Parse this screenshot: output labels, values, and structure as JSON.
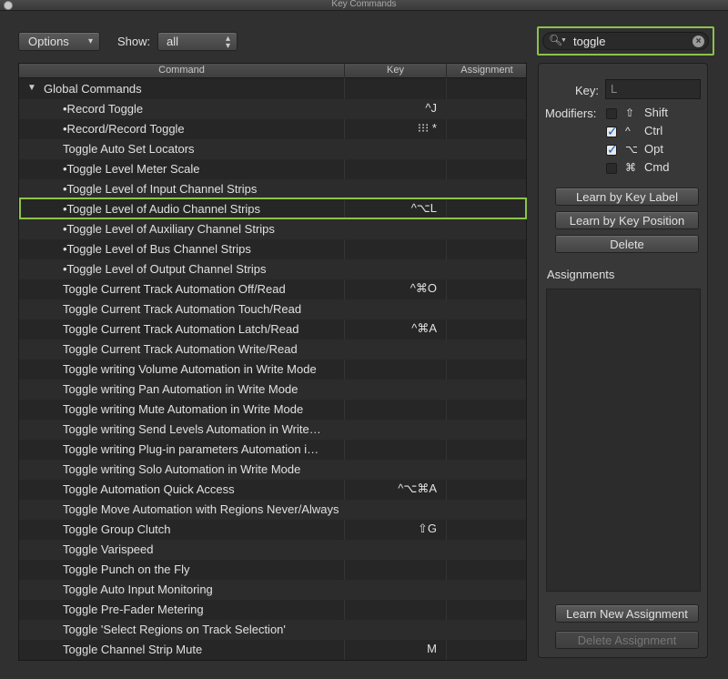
{
  "window": {
    "title": "Key Commands"
  },
  "toolbar": {
    "options_label": "Options",
    "show_label": "Show:",
    "show_value": "all"
  },
  "search": {
    "value": "toggle"
  },
  "table": {
    "headers": {
      "command": "Command",
      "key": "Key",
      "assignment": "Assignment"
    },
    "group": "Global Commands",
    "rows": [
      {
        "cmd": "•Record Toggle",
        "key": "^J"
      },
      {
        "cmd": "•Record/Record Toggle",
        "key": "⁝⁝⁝ *"
      },
      {
        "cmd": "Toggle Auto Set Locators",
        "key": ""
      },
      {
        "cmd": "•Toggle Level Meter Scale",
        "key": ""
      },
      {
        "cmd": "•Toggle Level of Input Channel Strips",
        "key": ""
      },
      {
        "cmd": "•Toggle Level of Audio Channel Strips",
        "key": "^⌥L"
      },
      {
        "cmd": "•Toggle Level of Auxiliary Channel Strips",
        "key": ""
      },
      {
        "cmd": "•Toggle Level of Bus Channel Strips",
        "key": ""
      },
      {
        "cmd": "•Toggle Level of Output Channel Strips",
        "key": ""
      },
      {
        "cmd": "Toggle Current Track Automation Off/Read",
        "key": "^⌘O"
      },
      {
        "cmd": "Toggle Current Track Automation Touch/Read",
        "key": ""
      },
      {
        "cmd": "Toggle Current Track Automation Latch/Read",
        "key": "^⌘A"
      },
      {
        "cmd": "Toggle Current Track Automation Write/Read",
        "key": ""
      },
      {
        "cmd": "Toggle writing Volume Automation in Write Mode",
        "key": ""
      },
      {
        "cmd": "Toggle writing Pan Automation in Write Mode",
        "key": ""
      },
      {
        "cmd": "Toggle writing Mute Automation in Write Mode",
        "key": ""
      },
      {
        "cmd": "Toggle writing Send Levels Automation in Write…",
        "key": ""
      },
      {
        "cmd": "Toggle writing Plug-in parameters Automation i…",
        "key": ""
      },
      {
        "cmd": "Toggle writing Solo Automation in Write Mode",
        "key": ""
      },
      {
        "cmd": "Toggle Automation Quick Access",
        "key": "^⌥⌘A"
      },
      {
        "cmd": "Toggle Move Automation with Regions Never/Always",
        "key": ""
      },
      {
        "cmd": "Toggle Group Clutch",
        "key": "⇧G"
      },
      {
        "cmd": "Toggle Varispeed",
        "key": ""
      },
      {
        "cmd": "Toggle Punch on the Fly",
        "key": ""
      },
      {
        "cmd": "Toggle Auto Input Monitoring",
        "key": ""
      },
      {
        "cmd": "Toggle Pre-Fader Metering",
        "key": ""
      },
      {
        "cmd": "Toggle 'Select Regions on Track Selection'",
        "key": ""
      },
      {
        "cmd": "Toggle Channel Strip Mute",
        "key": "M"
      }
    ]
  },
  "panel": {
    "key_label": "Key:",
    "key_value": "L",
    "modifiers_label": "Modifiers:",
    "modifiers": [
      {
        "symbol": "⇧",
        "name": "Shift",
        "checked": false
      },
      {
        "symbol": "^",
        "name": "Ctrl",
        "checked": true
      },
      {
        "symbol": "⌥",
        "name": "Opt",
        "checked": true
      },
      {
        "symbol": "⌘",
        "name": "Cmd",
        "checked": false
      }
    ],
    "learn_by_key_label": "Learn by Key Label",
    "learn_by_key_position": "Learn by Key Position",
    "delete_label": "Delete",
    "assignments_label": "Assignments",
    "learn_new_assignment": "Learn New Assignment",
    "delete_assignment": "Delete Assignment"
  },
  "colors": {
    "highlight": "#8bc34a",
    "background": "#303030",
    "checkbox_tick": "#1a5fb4"
  },
  "icons": {
    "search": "magnifier-icon",
    "clear": "clear-circle-icon",
    "disclosure": "triangle-down-icon"
  }
}
